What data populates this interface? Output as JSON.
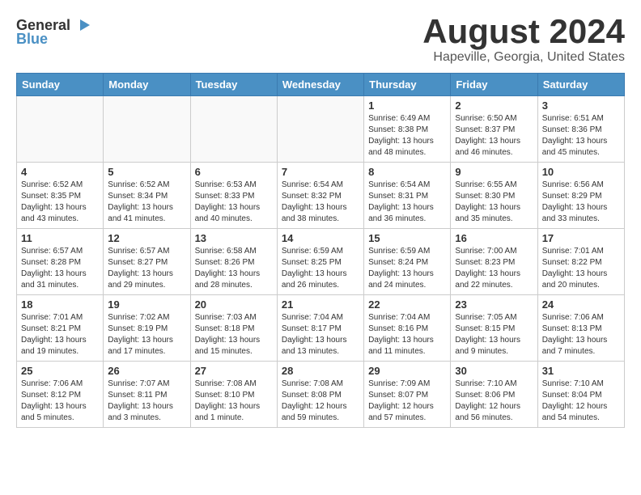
{
  "header": {
    "logo_general": "General",
    "logo_blue": "Blue",
    "month_year": "August 2024",
    "location": "Hapeville, Georgia, United States"
  },
  "days_of_week": [
    "Sunday",
    "Monday",
    "Tuesday",
    "Wednesday",
    "Thursday",
    "Friday",
    "Saturday"
  ],
  "weeks": [
    [
      {
        "day": "",
        "info": ""
      },
      {
        "day": "",
        "info": ""
      },
      {
        "day": "",
        "info": ""
      },
      {
        "day": "",
        "info": ""
      },
      {
        "day": "1",
        "info": "Sunrise: 6:49 AM\nSunset: 8:38 PM\nDaylight: 13 hours\nand 48 minutes."
      },
      {
        "day": "2",
        "info": "Sunrise: 6:50 AM\nSunset: 8:37 PM\nDaylight: 13 hours\nand 46 minutes."
      },
      {
        "day": "3",
        "info": "Sunrise: 6:51 AM\nSunset: 8:36 PM\nDaylight: 13 hours\nand 45 minutes."
      }
    ],
    [
      {
        "day": "4",
        "info": "Sunrise: 6:52 AM\nSunset: 8:35 PM\nDaylight: 13 hours\nand 43 minutes."
      },
      {
        "day": "5",
        "info": "Sunrise: 6:52 AM\nSunset: 8:34 PM\nDaylight: 13 hours\nand 41 minutes."
      },
      {
        "day": "6",
        "info": "Sunrise: 6:53 AM\nSunset: 8:33 PM\nDaylight: 13 hours\nand 40 minutes."
      },
      {
        "day": "7",
        "info": "Sunrise: 6:54 AM\nSunset: 8:32 PM\nDaylight: 13 hours\nand 38 minutes."
      },
      {
        "day": "8",
        "info": "Sunrise: 6:54 AM\nSunset: 8:31 PM\nDaylight: 13 hours\nand 36 minutes."
      },
      {
        "day": "9",
        "info": "Sunrise: 6:55 AM\nSunset: 8:30 PM\nDaylight: 13 hours\nand 35 minutes."
      },
      {
        "day": "10",
        "info": "Sunrise: 6:56 AM\nSunset: 8:29 PM\nDaylight: 13 hours\nand 33 minutes."
      }
    ],
    [
      {
        "day": "11",
        "info": "Sunrise: 6:57 AM\nSunset: 8:28 PM\nDaylight: 13 hours\nand 31 minutes."
      },
      {
        "day": "12",
        "info": "Sunrise: 6:57 AM\nSunset: 8:27 PM\nDaylight: 13 hours\nand 29 minutes."
      },
      {
        "day": "13",
        "info": "Sunrise: 6:58 AM\nSunset: 8:26 PM\nDaylight: 13 hours\nand 28 minutes."
      },
      {
        "day": "14",
        "info": "Sunrise: 6:59 AM\nSunset: 8:25 PM\nDaylight: 13 hours\nand 26 minutes."
      },
      {
        "day": "15",
        "info": "Sunrise: 6:59 AM\nSunset: 8:24 PM\nDaylight: 13 hours\nand 24 minutes."
      },
      {
        "day": "16",
        "info": "Sunrise: 7:00 AM\nSunset: 8:23 PM\nDaylight: 13 hours\nand 22 minutes."
      },
      {
        "day": "17",
        "info": "Sunrise: 7:01 AM\nSunset: 8:22 PM\nDaylight: 13 hours\nand 20 minutes."
      }
    ],
    [
      {
        "day": "18",
        "info": "Sunrise: 7:01 AM\nSunset: 8:21 PM\nDaylight: 13 hours\nand 19 minutes."
      },
      {
        "day": "19",
        "info": "Sunrise: 7:02 AM\nSunset: 8:19 PM\nDaylight: 13 hours\nand 17 minutes."
      },
      {
        "day": "20",
        "info": "Sunrise: 7:03 AM\nSunset: 8:18 PM\nDaylight: 13 hours\nand 15 minutes."
      },
      {
        "day": "21",
        "info": "Sunrise: 7:04 AM\nSunset: 8:17 PM\nDaylight: 13 hours\nand 13 minutes."
      },
      {
        "day": "22",
        "info": "Sunrise: 7:04 AM\nSunset: 8:16 PM\nDaylight: 13 hours\nand 11 minutes."
      },
      {
        "day": "23",
        "info": "Sunrise: 7:05 AM\nSunset: 8:15 PM\nDaylight: 13 hours\nand 9 minutes."
      },
      {
        "day": "24",
        "info": "Sunrise: 7:06 AM\nSunset: 8:13 PM\nDaylight: 13 hours\nand 7 minutes."
      }
    ],
    [
      {
        "day": "25",
        "info": "Sunrise: 7:06 AM\nSunset: 8:12 PM\nDaylight: 13 hours\nand 5 minutes."
      },
      {
        "day": "26",
        "info": "Sunrise: 7:07 AM\nSunset: 8:11 PM\nDaylight: 13 hours\nand 3 minutes."
      },
      {
        "day": "27",
        "info": "Sunrise: 7:08 AM\nSunset: 8:10 PM\nDaylight: 13 hours\nand 1 minute."
      },
      {
        "day": "28",
        "info": "Sunrise: 7:08 AM\nSunset: 8:08 PM\nDaylight: 12 hours\nand 59 minutes."
      },
      {
        "day": "29",
        "info": "Sunrise: 7:09 AM\nSunset: 8:07 PM\nDaylight: 12 hours\nand 57 minutes."
      },
      {
        "day": "30",
        "info": "Sunrise: 7:10 AM\nSunset: 8:06 PM\nDaylight: 12 hours\nand 56 minutes."
      },
      {
        "day": "31",
        "info": "Sunrise: 7:10 AM\nSunset: 8:04 PM\nDaylight: 12 hours\nand 54 minutes."
      }
    ]
  ]
}
